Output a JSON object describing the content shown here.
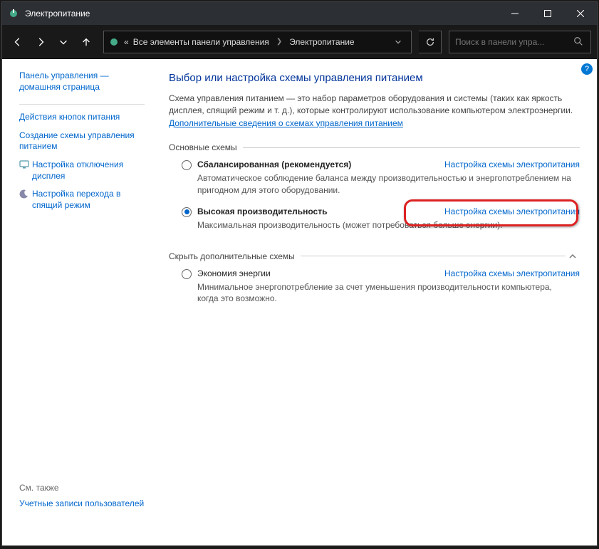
{
  "titlebar": {
    "title": "Электропитание"
  },
  "breadcrumb": {
    "prefix": "«",
    "root": "Все элементы панели управления",
    "leaf": "Электропитание"
  },
  "search": {
    "placeholder": "Поиск в панели упра..."
  },
  "sidebar": {
    "home1": "Панель управления —",
    "home2": "домашняя страница",
    "items": [
      {
        "label": "Действия кнопок питания"
      },
      {
        "label": "Создание схемы управления питанием"
      },
      {
        "label": "Настройка отключения дисплея",
        "icon": "display"
      },
      {
        "label": "Настройка перехода в спящий режим",
        "icon": "moon"
      }
    ],
    "seeAlsoLabel": "См. также",
    "seeAlso": "Учетные записи пользователей"
  },
  "main": {
    "heading": "Выбор или настройка схемы управления питанием",
    "desc": "Схема управления питанием — это набор параметров оборудования и системы (таких как яркость дисплея, спящий режим и т. д.), которые контролируют использование компьютером электроэнергии. ",
    "descLink": "Дополнительные сведения о схемах управления питанием",
    "section1": "Основные схемы",
    "section2": "Скрыть дополнительные схемы",
    "settingsLink": "Настройка схемы электропитания",
    "plans": [
      {
        "name": "Сбалансированная (рекомендуется)",
        "desc": "Автоматическое соблюдение баланса между производительностью и энергопотреблением на пригодном для этого оборудовании.",
        "checked": false
      },
      {
        "name": "Высокая производительность",
        "desc": "Максимальная производительность (может потребоваться больше энергии).",
        "checked": true
      }
    ],
    "extraPlan": {
      "name": "Экономия энергии",
      "desc": "Минимальное энергопотребление за счет уменьшения производительности компьютера, когда это возможно."
    }
  }
}
